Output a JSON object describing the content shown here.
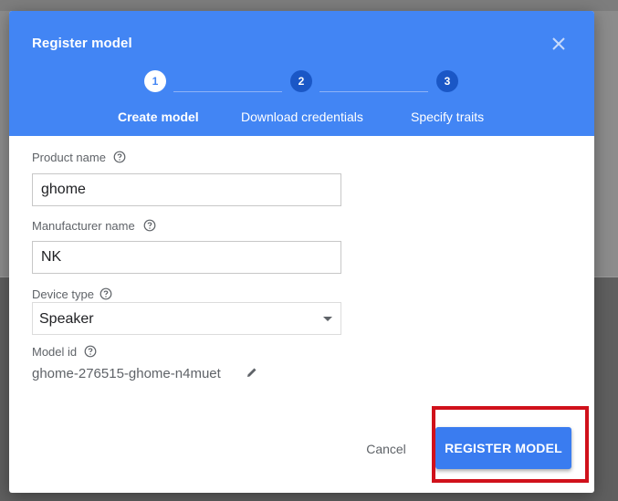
{
  "dialog": {
    "title": "Register model",
    "close_icon": "close-icon"
  },
  "stepper": {
    "steps": [
      {
        "number": "1",
        "label": "Create model",
        "state": "active"
      },
      {
        "number": "2",
        "label": "Download credentials",
        "state": "inactive"
      },
      {
        "number": "3",
        "label": "Specify traits",
        "state": "inactive"
      }
    ]
  },
  "form": {
    "product_name": {
      "label": "Product name",
      "value": "ghome",
      "help_icon": "help-circle-icon"
    },
    "manufacturer_name": {
      "label": "Manufacturer name",
      "value": "NK",
      "help_icon": "help-circle-icon"
    },
    "device_type": {
      "label": "Device type",
      "value": "Speaker",
      "help_icon": "help-circle-icon"
    },
    "model_id": {
      "label": "Model id",
      "value": "ghome-276515-ghome-n4muet",
      "help_icon": "help-circle-icon",
      "edit_icon": "pencil-icon"
    }
  },
  "footer": {
    "cancel_label": "Cancel",
    "register_label": "REGISTER MODEL"
  },
  "colors": {
    "header": "#4285f4",
    "primary_button": "#3a7cf0",
    "highlight": "#d0111b"
  }
}
